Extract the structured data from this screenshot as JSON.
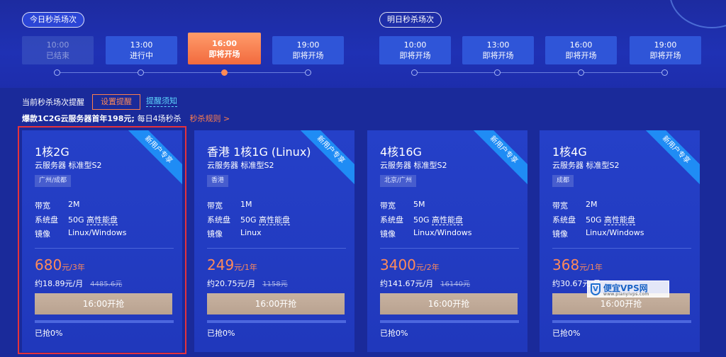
{
  "header": {
    "today_label": "今日秒杀场次",
    "tomorrow_label": "明日秒杀场次",
    "today_sessions": [
      {
        "time": "10:00",
        "status": "已结束"
      },
      {
        "time": "13:00",
        "status": "进行中"
      },
      {
        "time": "16:00",
        "status": "即将开场"
      },
      {
        "time": "19:00",
        "status": "即将开场"
      }
    ],
    "tomorrow_sessions": [
      {
        "time": "10:00",
        "status": "即将开场"
      },
      {
        "time": "13:00",
        "status": "即将开场"
      },
      {
        "time": "16:00",
        "status": "即将开场"
      },
      {
        "time": "19:00",
        "status": "即将开场"
      }
    ]
  },
  "notice": {
    "text": "当前秒杀场次提醒",
    "remind_button": "设置提醒",
    "notice_link": "提醒须知",
    "promo": "爆款1C2G云服务器首年198元;",
    "promo_sub": "每日4场秒杀",
    "rule_link": "秒杀规则 >"
  },
  "spec_labels": {
    "bandwidth": "带宽",
    "disk": "系统盘",
    "image": "镜像"
  },
  "cards": [
    {
      "ribbon": "新用户专享",
      "title": "1核2G",
      "subtitle": "云服务器 标准型S2",
      "region": "广州/成都",
      "bandwidth": "2M",
      "disk_size": "50G",
      "disk_type": "高性能盘",
      "image": "Linux/Windows",
      "price": "680",
      "price_unit": "元/3年",
      "monthly": "约18.89元/月",
      "original": "4485.6元",
      "button": "16:00开抢",
      "sold_label": "已抢0%",
      "sold_percent": 0
    },
    {
      "ribbon": "新用户专享",
      "title": "香港 1核1G (Linux)",
      "subtitle": "云服务器 标准型S2",
      "region": "香港",
      "bandwidth": "1M",
      "disk_size": "50G",
      "disk_type": "高性能盘",
      "image": "Linux",
      "price": "249",
      "price_unit": "元/1年",
      "monthly": "约20.75元/月",
      "original": "1158元",
      "button": "16:00开抢",
      "sold_label": "已抢0%",
      "sold_percent": 0
    },
    {
      "ribbon": "新用户专享",
      "title": "4核16G",
      "subtitle": "云服务器 标准型S2",
      "region": "北京/广州",
      "bandwidth": "5M",
      "disk_size": "50G",
      "disk_type": "高性能盘",
      "image": "Linux/Windows",
      "price": "3400",
      "price_unit": "元/2年",
      "monthly": "约141.67元/月",
      "original": "16140元",
      "button": "16:00开抢",
      "sold_label": "已抢0%",
      "sold_percent": 0
    },
    {
      "ribbon": "新用户专享",
      "title": "1核4G",
      "subtitle": "云服务器 标准型S2",
      "region": "成都",
      "bandwidth": "2M",
      "disk_size": "50G",
      "disk_type": "高性能盘",
      "image": "Linux/Windows",
      "price": "368",
      "price_unit": "元/1年",
      "monthly": "约30.67元/月",
      "original": "",
      "button": "16:00开抢",
      "sold_label": "已抢0%",
      "sold_percent": 0
    }
  ],
  "watermark": {
    "title": "便宜VPS网",
    "url": "www.pianyivps.com",
    "logo_char": "V"
  },
  "colors": {
    "accent": "#ff8a5a",
    "active_session": "#f26a3e",
    "ribbon": "#1f8cf5",
    "selection": "#e5323c"
  }
}
